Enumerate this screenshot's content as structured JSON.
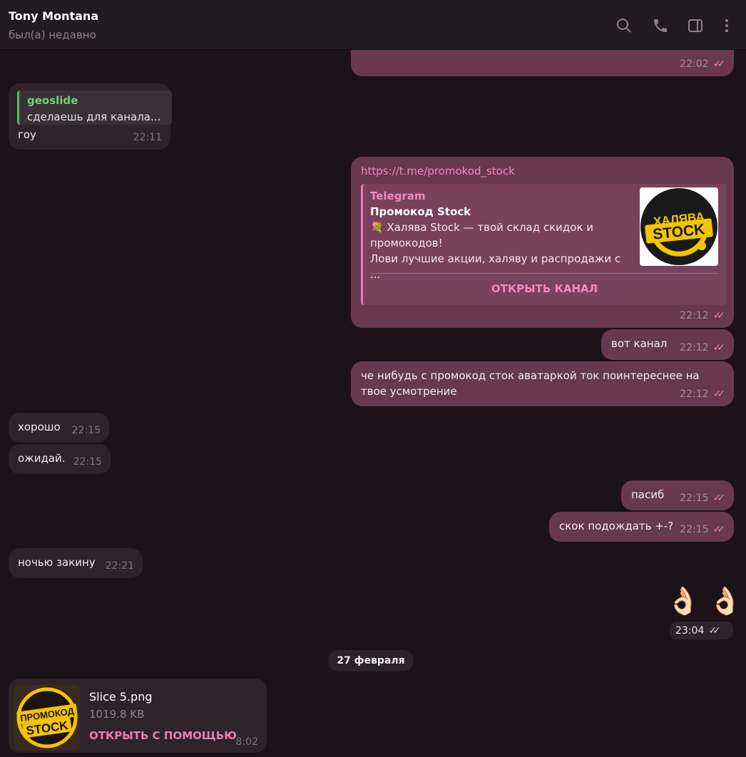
{
  "header": {
    "name": "Tony Montana",
    "status": "был(а) недавно",
    "icons": [
      "search-icon",
      "phone-icon",
      "sidebar-toggle-icon",
      "more-vertical-icon"
    ]
  },
  "messages": {
    "m1": {
      "time": "22:02"
    },
    "m2": {
      "reply_name": "geoslide",
      "reply_text": "сделаешь для канала...",
      "text": "гоу",
      "time": "22:11"
    },
    "m3": {
      "url": "https://t.me/promokod_stock",
      "site": "Telegram",
      "title": "Промокод Stock",
      "desc": "💐 Халява Stock — твой склад скидок и промокодов!\nЛови лучшие акции, халяву и распродажи с ...",
      "thumb_line1": "ХАЛЯВА",
      "thumb_line2": "STOCK",
      "button": "ОТКРЫТЬ КАНАЛ",
      "time": "22:12"
    },
    "m4": {
      "text": "вот канал",
      "time": "22:12"
    },
    "m5": {
      "text": "че нибудь с промокод сток аватаркой ток поинтереснее на твое усмотрение",
      "time": "22:12"
    },
    "m6": {
      "text": "хорошо",
      "time": "22:15"
    },
    "m7": {
      "text": "ожидай.",
      "time": "22:15"
    },
    "m8": {
      "text": "пасиб",
      "time": "22:15"
    },
    "m9": {
      "text": "скок подождать +-?",
      "time": "22:15"
    },
    "m10": {
      "text": "ночью закину",
      "time": "22:21"
    },
    "m11": {
      "emoji": "👌🏻 👌🏻",
      "time": "23:04"
    },
    "date_separator": "27 февраля",
    "m12": {
      "file_name": "Slice 5.png",
      "file_size": "1019.8 KB",
      "open_label": "ОТКРЫТЬ С ПОМОЩЬЮ",
      "thumb_line1": "ПРОМОКОД",
      "thumb_line2": "STOCK",
      "time": "8:02"
    }
  },
  "colors": {
    "accent": "#e77fb3",
    "outgoing_bubble": "#68384f",
    "incoming_bubble": "#2e2329",
    "background": "#1c1217",
    "reply_accent": "#57b85d"
  }
}
